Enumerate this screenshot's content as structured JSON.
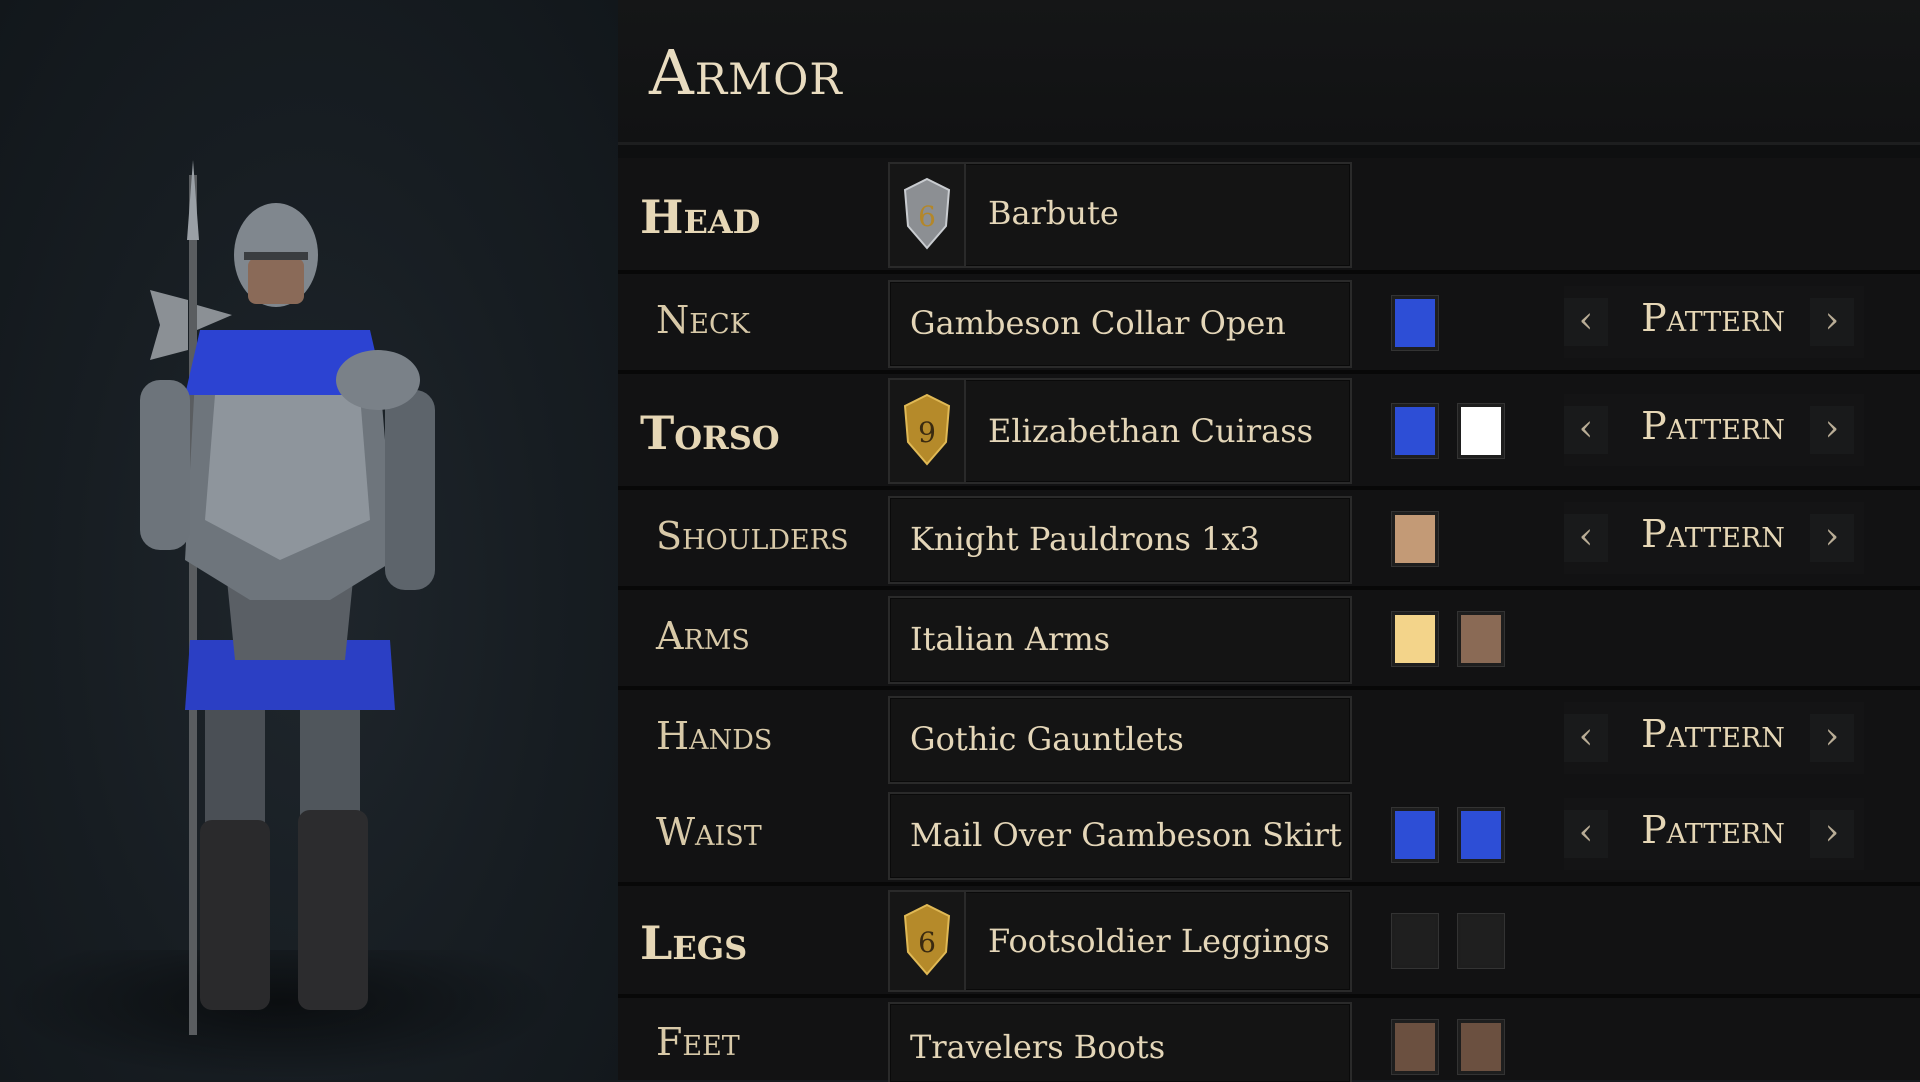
{
  "panel": {
    "title": "Armor"
  },
  "slots": [
    {
      "label": "Head",
      "item": "Barbute",
      "tier": "6"
    },
    {
      "label": "Neck",
      "item": "Gambeson Collar Open",
      "pattern": "Pattern"
    },
    {
      "label": "Torso",
      "item": "Elizabethan Cuirass",
      "tier": "9",
      "pattern": "Pattern"
    },
    {
      "label": "Shoulders",
      "item": "Knight Pauldrons 1x3",
      "pattern": "Pattern"
    },
    {
      "label": "Arms",
      "item": "Italian Arms"
    },
    {
      "label": "Hands",
      "item": "Gothic Gauntlets",
      "pattern": "Pattern"
    },
    {
      "label": "Waist",
      "item": "Mail Over Gambeson Skirt",
      "pattern": "Pattern"
    },
    {
      "label": "Legs",
      "item": "Footsoldier Leggings",
      "tier": "6"
    },
    {
      "label": "Feet",
      "item": "Travelers Boots"
    }
  ],
  "colors": {
    "neck": [
      "#2d4ed6"
    ],
    "torso": [
      "#2d4ed6",
      "#ffffff"
    ],
    "shoulders": [
      "#c39a76"
    ],
    "arms": [
      "#f3d48a",
      "#8a6a55"
    ],
    "waist": [
      "#2d4ed6",
      "#2d4ed6"
    ],
    "legs": [
      "#1f1f1f",
      "#1f1f1f"
    ],
    "feet": [
      "#6b5040",
      "#6b5040"
    ]
  },
  "icons": {
    "tier_badge": "shield-icon",
    "prev": "chevron-left-icon",
    "next": "chevron-right-icon"
  }
}
